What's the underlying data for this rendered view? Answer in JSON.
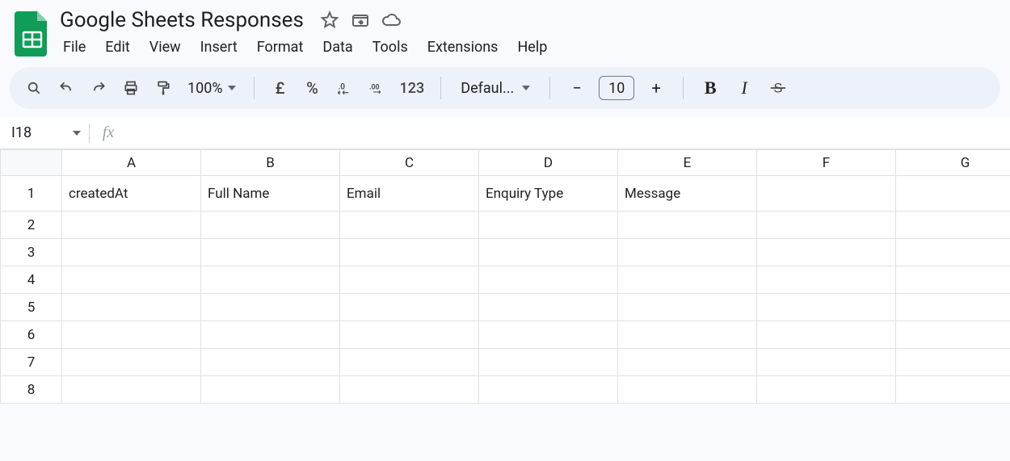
{
  "doc": {
    "title": "Google Sheets Responses"
  },
  "menu": {
    "file": "File",
    "edit": "Edit",
    "view": "View",
    "insert": "Insert",
    "format": "Format",
    "data": "Data",
    "tools": "Tools",
    "extensions": "Extensions",
    "help": "Help"
  },
  "toolbar": {
    "zoom": "100%",
    "currency_symbol": "£",
    "percent": "%",
    "dec_decrease": ".0",
    "dec_increase": ".00",
    "num_format": "123",
    "font_name": "Defaul...",
    "font_size": "10",
    "minus": "−",
    "plus": "+",
    "bold": "B",
    "italic": "I"
  },
  "namebox": {
    "cell_ref": "I18",
    "fx_label": "fx"
  },
  "grid": {
    "columns": [
      "A",
      "B",
      "C",
      "D",
      "E",
      "F",
      "G"
    ],
    "rows": [
      "1",
      "2",
      "3",
      "4",
      "5",
      "6",
      "7",
      "8"
    ],
    "data": {
      "A1": "createdAt",
      "B1": "Full Name",
      "C1": "Email",
      "D1": "Enquiry Type",
      "E1": "Message"
    }
  }
}
